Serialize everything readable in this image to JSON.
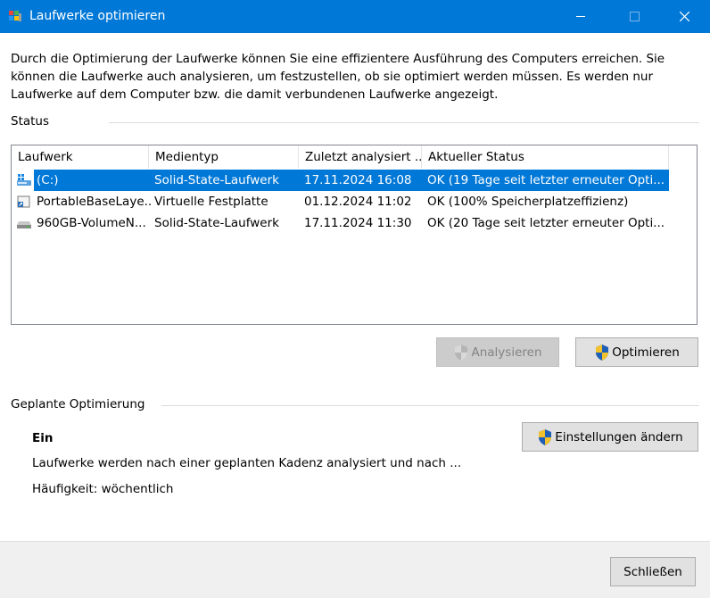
{
  "window": {
    "title": "Laufwerke optimieren",
    "controls": [
      "minimize-icon",
      "maximize-icon",
      "close-icon"
    ]
  },
  "description": "Durch die Optimierung der Laufwerke können Sie eine effizientere Ausführung des Computers erreichen. Sie können die Laufwerke auch analysieren, um festzustellen, ob sie optimiert werden müssen. Es werden nur Laufwerke auf dem Computer bzw. die damit verbundenen Laufwerke angezeigt.",
  "status": {
    "label": "Status",
    "columns": [
      "Laufwerk",
      "Medientyp",
      "Zuletzt analysiert ...",
      "Aktueller Status"
    ],
    "drives": [
      {
        "name": "(C:)",
        "media": "Solid-State-Laufwerk",
        "last": "17.11.2024 16:08",
        "state": "OK (19 Tage seit letzter erneuter Opti...",
        "icon": "system-drive-icon",
        "selected": true
      },
      {
        "name": "PortableBaseLaye...",
        "media": "Virtuelle Festplatte",
        "last": "01.12.2024 11:02",
        "state": "OK (100% Speicherplatzeffizienz)",
        "icon": "virtual-disk-icon",
        "selected": false
      },
      {
        "name": "960GB-VolumeN...",
        "media": "Solid-State-Laufwerk",
        "last": "17.11.2024 11:30",
        "state": "OK (20 Tage seit letzter erneuter Opti...",
        "icon": "hard-drive-icon",
        "selected": false
      }
    ],
    "analyze_label": "Analysieren",
    "optimize_label": "Optimieren"
  },
  "schedule": {
    "label": "Geplante Optimierung",
    "state": "Ein",
    "settings_label": "Einstellungen ändern",
    "info": "Laufwerke werden nach einer geplanten Kadenz analysiert und nach ...",
    "frequency": "Häufigkeit: wöchentlich"
  },
  "footer": {
    "close_label": "Schließen"
  },
  "colors": {
    "accent": "#0078d7",
    "footer_bg": "#f0f0f0",
    "button_bg": "#e1e1e1",
    "button_disabled_bg": "#cccccc"
  }
}
